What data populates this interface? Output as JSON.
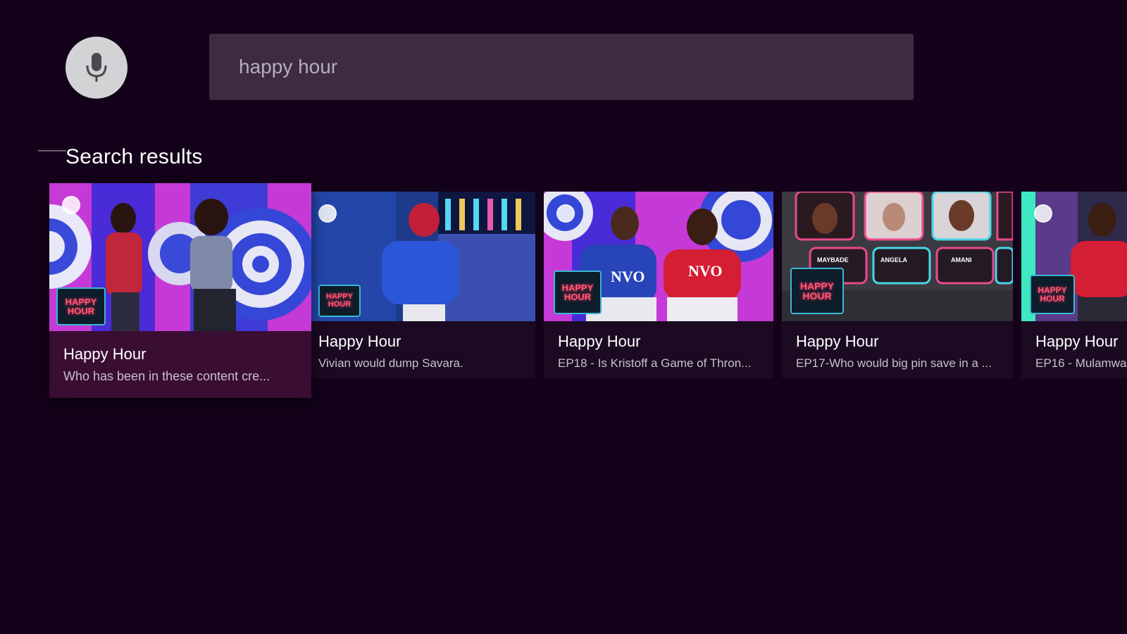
{
  "search": {
    "query": "happy hour",
    "mic_icon": "mic-icon"
  },
  "results": {
    "title": "Search results",
    "cards": [
      {
        "title": "Happy Hour",
        "subtitle": "Who has been in these content cre..."
      },
      {
        "title": "Happy Hour",
        "subtitle": "Vivian would dump Savara."
      },
      {
        "title": "Happy Hour",
        "subtitle": "EP18 - Is Kristoff a Game of Thron..."
      },
      {
        "title": "Happy Hour",
        "subtitle": "EP17-Who would big pin save in a ..."
      },
      {
        "title": "Happy Hour",
        "subtitle": "EP16 - Mulamwa"
      }
    ]
  },
  "thumbnail_logo": {
    "line1": "HAPPY",
    "line2": "HOUR"
  },
  "thumbnail_text": {
    "shirt": "NVO",
    "labels": [
      "MAYBADE",
      "ANGELA",
      "AMANI"
    ]
  },
  "colors": {
    "background": "#14021a",
    "search_bg": "#3d2b42",
    "focused_card": "#3a0d33",
    "card_bg": "#1b0a22"
  }
}
